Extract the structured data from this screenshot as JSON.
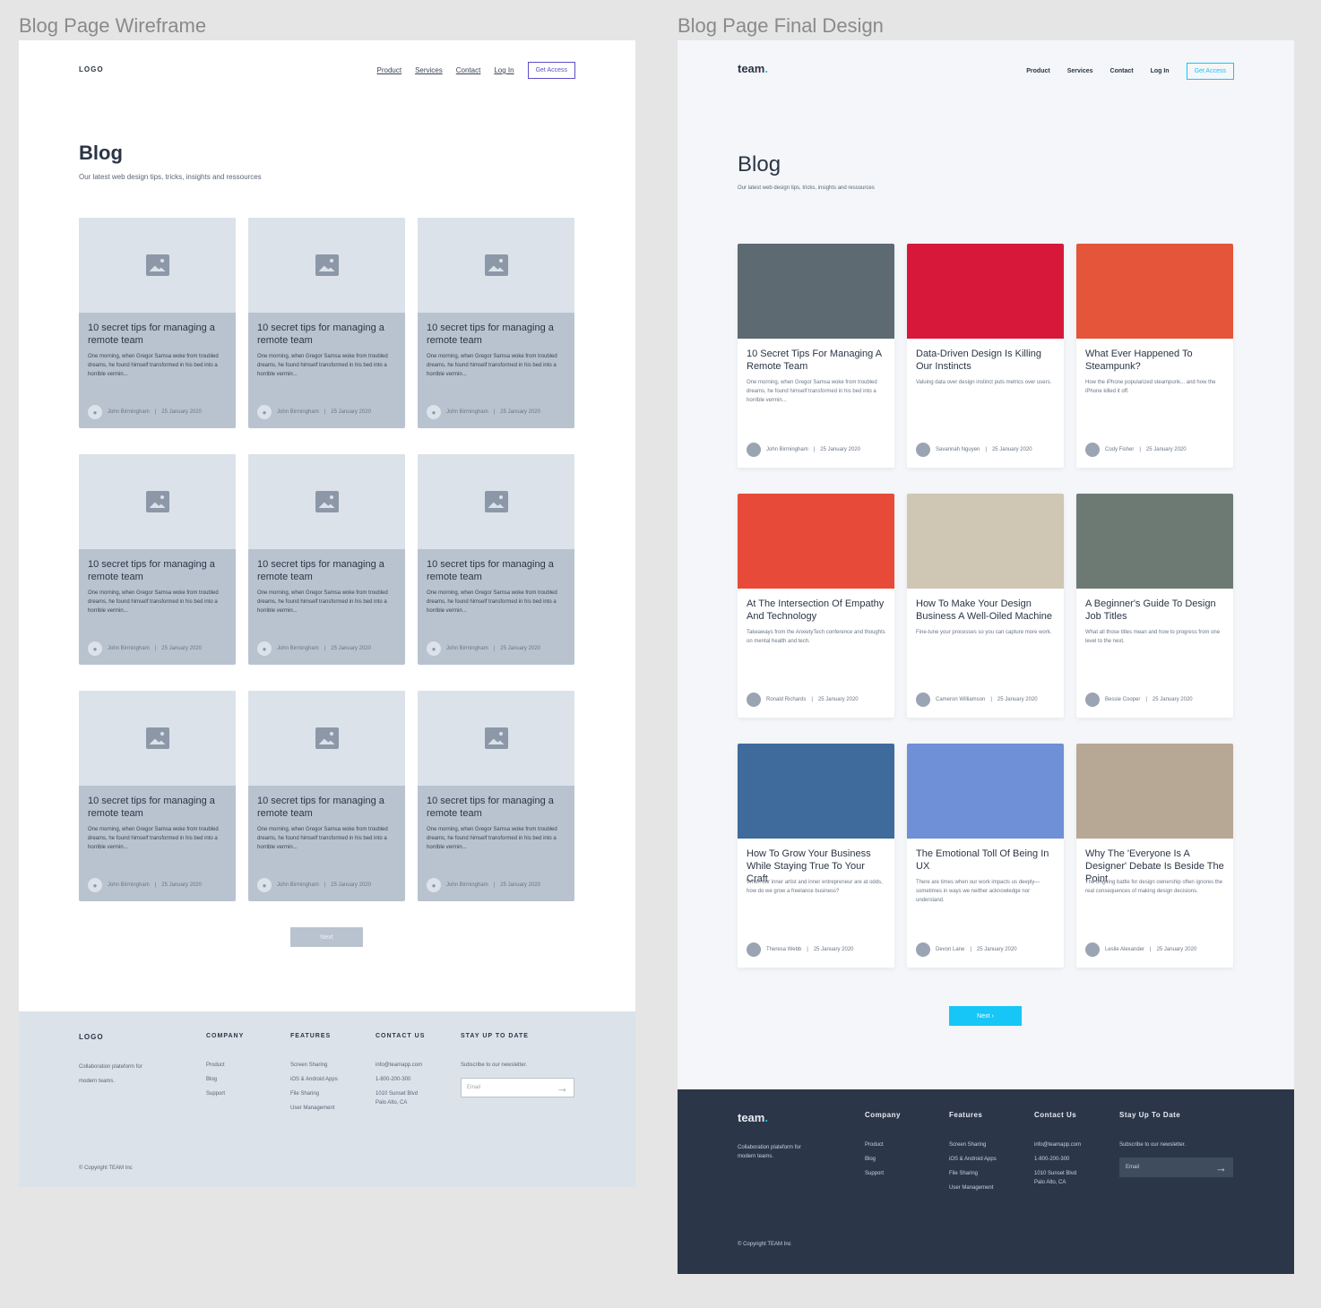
{
  "labels": {
    "wireframe": "Blog Page Wireframe",
    "final": "Blog Page Final Design"
  },
  "nav": {
    "logo_wire": "LOGO",
    "logo_final": "team",
    "logo_dot": ".",
    "items": [
      "Product",
      "Services",
      "Contact",
      "Log In"
    ],
    "cta": "Get Access"
  },
  "hero": {
    "title": "Blog",
    "subtitle": "Our latest web design tips, tricks, insights and ressources"
  },
  "wire_card": {
    "title": "10 secret tips for managing a remote team",
    "body": "One morning, when Gregor Samsa woke from troubled dreams, he found himself transformed in his bed into a horrible vermin...",
    "author": "John Birmingham",
    "date": "25 January 2020"
  },
  "final_cards": [
    {
      "title": "10 Secret Tips For Managing A Remote Team",
      "body": "One morning, when Gregor Samsa woke from troubled dreams, he found himself transformed in his bed into a horrible vermin...",
      "author": "John Birmingham",
      "date": "25 January 2020"
    },
    {
      "title": "Data-Driven Design Is Killing Our Instincts",
      "body": "Valuing data over design instinct puts metrics over users.",
      "author": "Savannah Nguyen",
      "date": "25 January 2020"
    },
    {
      "title": "What Ever Happened To Steampunk?",
      "body": "How the iPhone popularized steampunk... and how the iPhone killed it off.",
      "author": "Cody Fisher",
      "date": "25 January 2020"
    },
    {
      "title": "At The Intersection Of Empathy And Technology",
      "body": "Takeaways from the AnxietyTech conference and thoughts on mental health and tech.",
      "author": "Ronald Richards",
      "date": "25 January 2020"
    },
    {
      "title": "How To Make Your Design Business A Well-Oiled Machine",
      "body": "Fine-tune your processes so you can capture more work.",
      "author": "Cameron Williamson",
      "date": "25 January 2020"
    },
    {
      "title": "A Beginner's Guide To Design Job Titles",
      "body": "What all those titles mean and how to progress from one level to the next.",
      "author": "Bessie Cooper",
      "date": "25 January 2020"
    },
    {
      "title": "How To Grow Your Business While Staying True To Your Craft",
      "body": "When our inner artist and inner entrepreneur are at odds, how do we grow a freelance business?",
      "author": "Theresa Webb",
      "date": "25 January 2020"
    },
    {
      "title": "The Emotional Toll Of Being In UX",
      "body": "There are times when our work impacts us deeply—sometimes in ways we neither acknowledge nor understand.",
      "author": "Devon Lane",
      "date": "25 January 2020"
    },
    {
      "title": "Why The 'Everyone Is A Designer' Debate Is Beside The Point",
      "body": "The ongoing battle for design ownership often ignores the real consequences of making design decisions.",
      "author": "Leslie Alexander",
      "date": "25 January 2020"
    }
  ],
  "image_colors": [
    "#5e6a72",
    "#d8183a",
    "#e4553a",
    "#e84a3a",
    "#cfc6b4",
    "#6c7a73",
    "#3e6b9c",
    "#6f8fd6",
    "#b7a795"
  ],
  "next": {
    "wire": "Next",
    "final": "Next ›"
  },
  "footer": {
    "logo_wire": "LOGO",
    "logo_final": "team",
    "tagline": "Collaboration plateform for modern teams.",
    "company_wire": "COMPANY",
    "company_final": "Company",
    "company_items": [
      "Product",
      "Blog",
      "Support"
    ],
    "features_wire": "FEATURES",
    "features_final": "Features",
    "features_items": [
      "Screen Sharing",
      "iOS & Android Apps",
      "File Sharing",
      "User Management"
    ],
    "contact_wire": "CONTACT US",
    "contact_final": "Contact Us",
    "contact_email": "info@teamapp.com",
    "contact_phone": "1-800-200-300",
    "contact_address1": "1010 Sunset Blvd",
    "contact_address2": "Palo Alto, CA",
    "stay_wire": "STAY UP TO DATE",
    "stay_final": "Stay Up To Date",
    "subscribe": "Subscribe to our newsletter.",
    "email_placeholder": "Email",
    "copyright": "© Copyright TEAM Inc"
  }
}
